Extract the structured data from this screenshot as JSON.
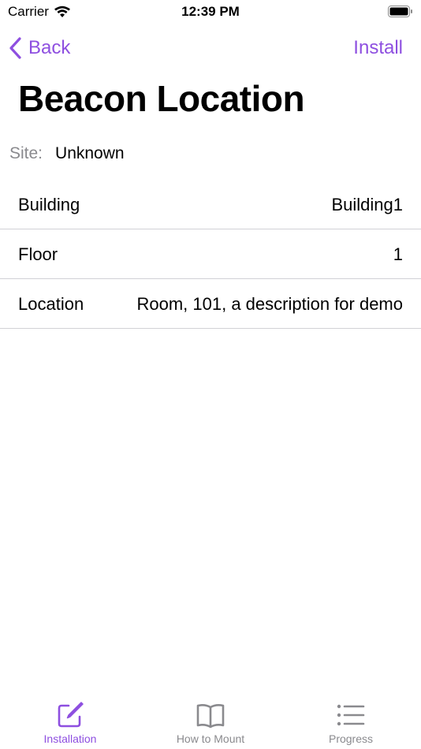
{
  "status_bar": {
    "carrier": "Carrier",
    "time": "12:39 PM"
  },
  "nav": {
    "back_label": "Back",
    "install_label": "Install"
  },
  "page": {
    "title": "Beacon Location",
    "site_label": "Site:",
    "site_value": "Unknown"
  },
  "rows": [
    {
      "label": "Building",
      "value": "Building1"
    },
    {
      "label": "Floor",
      "value": "1"
    },
    {
      "label": "Location",
      "value": "Room, 101, a description for demo"
    }
  ],
  "tabs": [
    {
      "label": "Installation",
      "icon": "edit-icon",
      "active": true
    },
    {
      "label": "How to Mount",
      "icon": "book-icon",
      "active": false
    },
    {
      "label": "Progress",
      "icon": "list-icon",
      "active": false
    }
  ],
  "colors": {
    "accent": "#8e4fe0",
    "secondary_text": "#8a8a8e",
    "separator": "#d1d1d6"
  }
}
